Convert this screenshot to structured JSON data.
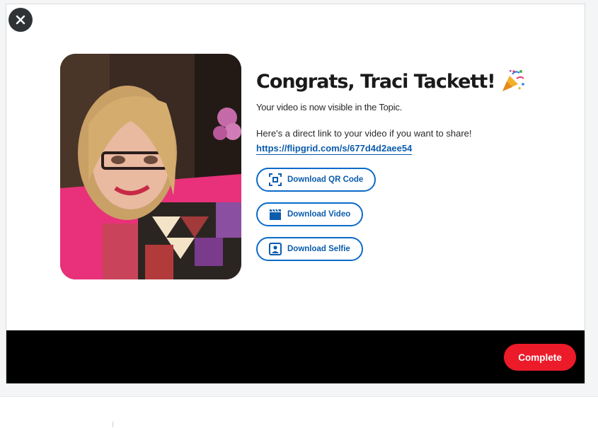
{
  "dialog": {
    "close_icon": "close-icon",
    "title": "Congrats, Traci Tackett!",
    "title_icon": "party-popper-icon",
    "subtitle": "Your video is now visible in the Topic.",
    "share_text": "Here's a direct link to your video if you want to share!",
    "share_link": "https://flipgrid.com/s/677d4d2aee54",
    "buttons": [
      {
        "label": "Download QR Code",
        "icon": "qr-code-icon"
      },
      {
        "label": "Download Video",
        "icon": "video-clapper-icon"
      },
      {
        "label": "Download Selfie",
        "icon": "portrait-icon"
      }
    ]
  },
  "footer": {
    "complete_label": "Complete"
  },
  "colors": {
    "accent_blue": "#0b6bc9",
    "complete_red": "#ec1b2a",
    "footer_bg": "#000000"
  }
}
